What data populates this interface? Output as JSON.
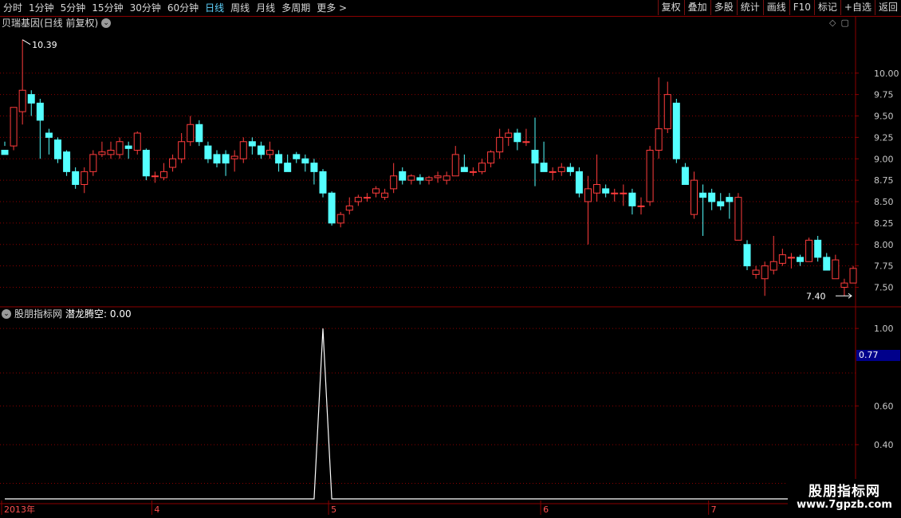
{
  "toolbar": {
    "periods": [
      {
        "label": "分时",
        "active": false
      },
      {
        "label": "1分钟",
        "active": false
      },
      {
        "label": "5分钟",
        "active": false
      },
      {
        "label": "15分钟",
        "active": false
      },
      {
        "label": "30分钟",
        "active": false
      },
      {
        "label": "60分钟",
        "active": false
      },
      {
        "label": "日线",
        "active": true
      },
      {
        "label": "周线",
        "active": false
      },
      {
        "label": "月线",
        "active": false
      },
      {
        "label": "多周期",
        "active": false
      },
      {
        "label": "更多 >",
        "active": false
      }
    ],
    "buttons": [
      "复权",
      "叠加",
      "多股",
      "统计",
      "画线",
      "F10",
      "标记",
      "+自选",
      "返回"
    ]
  },
  "main_panel": {
    "title": "贝瑞基因(日线 前复权)",
    "high_label": "10.39",
    "low_label": "7.40"
  },
  "indicator_panel": {
    "title": "股朋指标网",
    "indicator_label": "潜龙腾空: 0.00",
    "current_value_tag": "0.77"
  },
  "watermark": {
    "line1": "股朋指标网",
    "line2": "www.7gpzb.com"
  },
  "colors": {
    "up": "#ff3c3c",
    "down": "#54ffff",
    "grid": "#8b0000",
    "background": "#000000",
    "line": "#ffffff"
  },
  "chart_data": [
    {
      "type": "candlestick",
      "title": "贝瑞基因(日线 前复权)",
      "ylim": [
        7.3,
        10.5
      ],
      "y_ticks": [
        7.5,
        7.75,
        8.0,
        8.25,
        8.5,
        8.75,
        9.0,
        9.25,
        9.5,
        9.75,
        10.0
      ],
      "x_labels": [
        "2013年",
        "4",
        "5",
        "6",
        "7"
      ],
      "annotations": [
        {
          "text": "10.39",
          "kind": "high"
        },
        {
          "text": "7.40",
          "kind": "low"
        }
      ],
      "candles": [
        [
          9.1,
          9.05,
          9.2,
          9.15
        ],
        [
          9.15,
          9.6,
          9.55,
          9.1
        ],
        [
          9.55,
          9.8,
          10.39,
          9.4
        ],
        [
          9.75,
          9.65,
          9.8,
          9.5
        ],
        [
          9.65,
          9.45,
          9.7,
          9.0
        ],
        [
          9.3,
          9.25,
          9.35,
          9.05
        ],
        [
          9.22,
          9.0,
          9.25,
          8.95
        ],
        [
          9.08,
          8.85,
          9.1,
          8.8
        ],
        [
          8.85,
          8.7,
          8.9,
          8.65
        ],
        [
          8.7,
          8.85,
          8.9,
          8.6
        ],
        [
          8.85,
          9.05,
          9.1,
          8.8
        ],
        [
          9.05,
          9.08,
          9.2,
          9.02
        ],
        [
          9.05,
          9.1,
          9.2,
          9.0
        ],
        [
          9.05,
          9.2,
          9.25,
          9.0
        ],
        [
          9.15,
          9.12,
          9.2,
          9.0
        ],
        [
          9.1,
          9.3,
          9.32,
          9.05
        ],
        [
          9.1,
          8.8,
          9.12,
          8.75
        ],
        [
          8.8,
          8.8,
          8.85,
          8.72
        ],
        [
          8.78,
          8.85,
          8.95,
          8.75
        ],
        [
          8.9,
          9.0,
          9.05,
          8.85
        ],
        [
          9.0,
          9.2,
          9.3,
          8.95
        ],
        [
          9.2,
          9.4,
          9.5,
          9.15
        ],
        [
          9.4,
          9.2,
          9.45,
          9.15
        ],
        [
          9.15,
          9.0,
          9.2,
          8.95
        ],
        [
          9.05,
          8.95,
          9.1,
          8.9
        ],
        [
          9.05,
          8.95,
          9.1,
          8.8
        ],
        [
          9.0,
          9.03,
          9.1,
          8.85
        ],
        [
          9.0,
          9.2,
          9.25,
          8.95
        ],
        [
          9.2,
          9.15,
          9.25,
          9.05
        ],
        [
          9.15,
          9.05,
          9.2,
          9.0
        ],
        [
          9.05,
          9.1,
          9.2,
          9.0
        ],
        [
          9.05,
          8.95,
          9.1,
          8.85
        ],
        [
          8.95,
          8.85,
          9.05,
          8.85
        ],
        [
          9.05,
          9.0,
          9.08,
          8.95
        ],
        [
          9.0,
          8.95,
          9.05,
          8.85
        ],
        [
          8.95,
          8.85,
          9.0,
          8.7
        ],
        [
          8.85,
          8.6,
          8.88,
          8.55
        ],
        [
          8.6,
          8.25,
          8.62,
          8.22
        ],
        [
          8.25,
          8.35,
          8.38,
          8.2
        ],
        [
          8.4,
          8.45,
          8.55,
          8.35
        ],
        [
          8.5,
          8.55,
          8.58,
          8.45
        ],
        [
          8.55,
          8.55,
          8.6,
          8.5
        ],
        [
          8.6,
          8.65,
          8.68,
          8.55
        ],
        [
          8.55,
          8.6,
          8.65,
          8.52
        ],
        [
          8.65,
          8.8,
          8.95,
          8.6
        ],
        [
          8.85,
          8.75,
          8.9,
          8.7
        ],
        [
          8.75,
          8.8,
          8.82,
          8.7
        ],
        [
          8.78,
          8.75,
          8.82,
          8.7
        ],
        [
          8.75,
          8.78,
          8.8,
          8.7
        ],
        [
          8.78,
          8.8,
          8.85,
          8.72
        ],
        [
          8.75,
          8.8,
          8.85,
          8.7
        ],
        [
          8.8,
          9.05,
          9.15,
          8.8
        ],
        [
          8.9,
          8.85,
          9.05,
          8.85
        ],
        [
          8.85,
          8.85,
          8.9,
          8.8
        ],
        [
          8.85,
          8.95,
          9.0,
          8.82
        ],
        [
          8.95,
          9.08,
          9.1,
          8.9
        ],
        [
          9.08,
          9.25,
          9.35,
          9.0
        ],
        [
          9.25,
          9.3,
          9.35,
          9.15
        ],
        [
          9.3,
          9.2,
          9.35,
          9.1
        ],
        [
          9.2,
          9.2,
          9.35,
          9.15
        ],
        [
          9.1,
          8.95,
          9.48,
          8.68
        ],
        [
          8.95,
          8.85,
          9.2,
          8.85
        ],
        [
          8.85,
          8.85,
          8.9,
          8.75
        ],
        [
          8.85,
          8.9,
          8.95,
          8.8
        ],
        [
          8.9,
          8.85,
          8.95,
          8.8
        ],
        [
          8.85,
          8.6,
          8.9,
          8.55
        ],
        [
          8.5,
          8.65,
          8.8,
          8.0
        ],
        [
          8.6,
          8.7,
          9.05,
          8.5
        ],
        [
          8.65,
          8.6,
          8.7,
          8.55
        ],
        [
          8.6,
          8.6,
          8.65,
          8.5
        ],
        [
          8.6,
          8.6,
          8.7,
          8.45
        ],
        [
          8.6,
          8.45,
          8.65,
          8.35
        ],
        [
          8.45,
          8.45,
          8.55,
          8.35
        ],
        [
          8.5,
          9.1,
          9.15,
          8.45
        ],
        [
          9.1,
          9.35,
          9.95,
          9.0
        ],
        [
          9.35,
          9.75,
          9.9,
          9.3
        ],
        [
          9.65,
          9.0,
          9.7,
          8.95
        ],
        [
          8.9,
          8.7,
          8.95,
          8.8
        ],
        [
          8.35,
          8.75,
          8.85,
          8.3
        ],
        [
          8.6,
          8.55,
          8.7,
          8.1
        ],
        [
          8.6,
          8.5,
          8.65,
          8.4
        ],
        [
          8.5,
          8.45,
          8.6,
          8.4
        ],
        [
          8.55,
          8.5,
          8.6,
          8.3
        ],
        [
          8.05,
          8.55,
          8.6,
          8.05
        ],
        [
          8.0,
          7.75,
          8.05,
          7.7
        ],
        [
          7.65,
          7.7,
          7.75,
          7.6
        ],
        [
          7.6,
          7.75,
          7.8,
          7.4
        ],
        [
          7.7,
          7.8,
          8.1,
          7.65
        ],
        [
          7.78,
          7.88,
          7.95,
          7.75
        ],
        [
          7.85,
          7.85,
          7.9,
          7.72
        ],
        [
          7.85,
          7.8,
          7.88,
          7.75
        ],
        [
          7.8,
          8.05,
          8.08,
          7.8
        ],
        [
          8.05,
          7.85,
          8.1,
          7.8
        ],
        [
          7.85,
          7.7,
          7.9,
          7.7
        ],
        [
          7.6,
          7.82,
          7.88,
          7.6
        ],
        [
          7.5,
          7.55,
          7.6,
          7.4
        ],
        [
          7.55,
          7.72,
          7.75,
          7.55
        ]
      ]
    },
    {
      "type": "line",
      "title": "潜龙腾空",
      "ylim": [
        0.12,
        1.05
      ],
      "y_ticks": [
        0.2,
        0.4,
        0.6,
        0.77,
        1.0
      ],
      "series": [
        {
          "name": "潜龙腾空",
          "spike_index": 36,
          "peak_value": 1.0,
          "base_value": 0.0
        }
      ]
    }
  ]
}
